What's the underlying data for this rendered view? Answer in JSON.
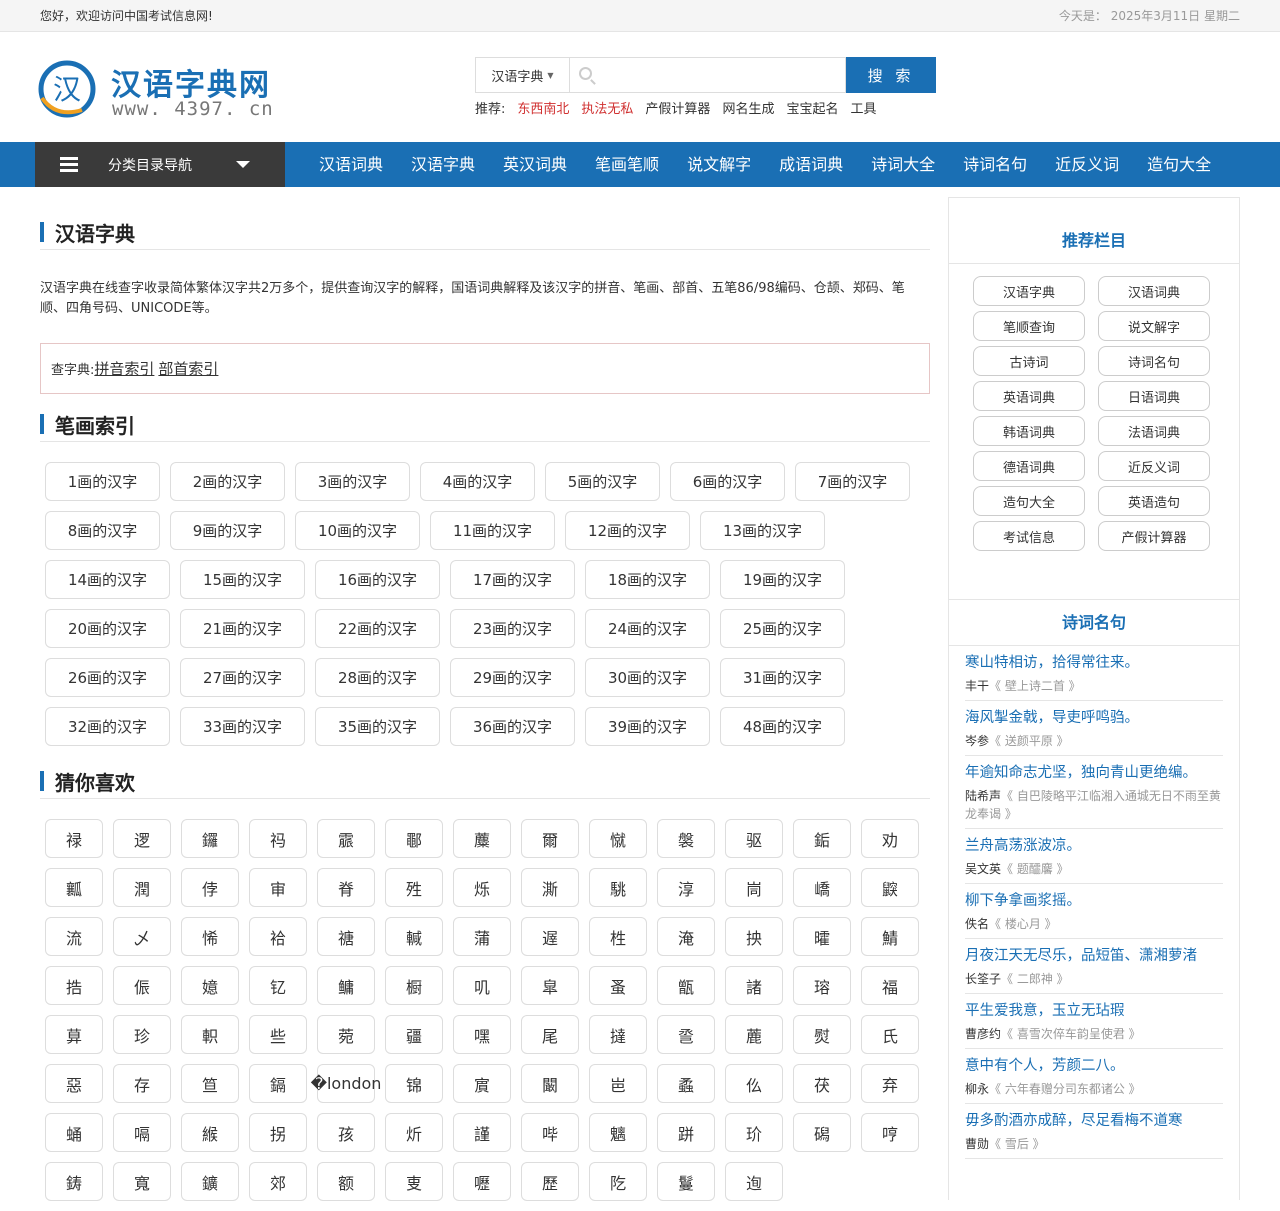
{
  "topbar": {
    "welcome": "您好，欢迎访问中国考试信息网!",
    "today": "今天是：  2025年3月11日 星期二"
  },
  "logo": {
    "name": "汉语字典网",
    "url": "www. 4397. cn",
    "mark": "汉"
  },
  "search": {
    "category": "汉语字典",
    "placeholder": "",
    "button": "搜 索"
  },
  "recommend": {
    "label": "推荐:",
    "hot": [
      "东西南北",
      "执法无私"
    ],
    "links": [
      "产假计算器",
      "网名生成",
      "宝宝起名",
      "工具"
    ]
  },
  "nav": {
    "category_menu": "分类目录导航",
    "links": [
      "汉语词典",
      "汉语字典",
      "英汉词典",
      "笔画笔顺",
      "说文解字",
      "成语词典",
      "诗词大全",
      "诗词名句",
      "近反义词",
      "造句大全"
    ]
  },
  "main": {
    "section1_title": "汉语字典",
    "description": "汉语字典在线查字收录简体繁体汉字共2万多个，提供查询汉字的解释，国语词典解释及该汉字的拼音、笔画、部首、五笔86/98编码、仓颉、郑码、笔顺、四角号码、UNICODE等。",
    "lookup_label": "查字典:",
    "lookup_links": [
      "拼音索引",
      "部首索引"
    ],
    "section2_title": "笔画索引",
    "strokes": [
      "1画的汉字",
      "2画的汉字",
      "3画的汉字",
      "4画的汉字",
      "5画的汉字",
      "6画的汉字",
      "7画的汉字",
      "8画的汉字",
      "9画的汉字",
      "10画的汉字",
      "11画的汉字",
      "12画的汉字",
      "13画的汉字",
      "14画的汉字",
      "15画的汉字",
      "16画的汉字",
      "17画的汉字",
      "18画的汉字",
      "19画的汉字",
      "20画的汉字",
      "21画的汉字",
      "22画的汉字",
      "23画的汉字",
      "24画的汉字",
      "25画的汉字",
      "26画的汉字",
      "27画的汉字",
      "28画的汉字",
      "29画的汉字",
      "30画的汉字",
      "31画的汉字",
      "32画的汉字",
      "33画的汉字",
      "35画的汉字",
      "36画的汉字",
      "39画的汉字",
      "48画的汉字"
    ],
    "section3_title": "猜你喜欢",
    "chars": [
      "禄",
      "逻",
      "鑼",
      "祃",
      "霢",
      "鄳",
      "蘪",
      "爾",
      "憱",
      "褩",
      "驱",
      "銗",
      "劝",
      "瓤",
      "潤",
      "侼",
      "审",
      "脊",
      "殅",
      "烁",
      "澌",
      "駣",
      "淳",
      "峝",
      "嶠",
      "鼵",
      "流",
      "乄",
      "悕",
      "袷",
      "禟",
      "輱",
      "蒲",
      "遟",
      "栍",
      "淹",
      "抰",
      "曤",
      "鯖",
      "捁",
      "侲",
      "嬑",
      "钇",
      "鳙",
      "橱",
      "叽",
      "皐",
      "蚤",
      "甑",
      "諸",
      "瑢",
      "福",
      "萛",
      "珍",
      "軹",
      "些",
      "菀",
      "疆",
      "嘿",
      "尾",
      "撻",
      "巹",
      "蔍",
      "熨",
      "氏",
      "惡",
      "存",
      "笪",
      "鎘",
      "�london",
      "锦",
      "賔",
      "闞",
      "岜",
      "蟊",
      "仫",
      "茯",
      "弃",
      "蛹",
      "嗝",
      "緱",
      "拐",
      "孩",
      "炘",
      "謹",
      "哔",
      "魑",
      "跰",
      "玠",
      "磶",
      "哼",
      "鋳",
      "寬",
      "鑛",
      "郊",
      "额",
      "叓",
      "嚦",
      "歷",
      "阣",
      "鬘",
      "迿"
    ]
  },
  "sidebar": {
    "recommend_title": "推荐栏目",
    "recommend_items": [
      "汉语字典",
      "汉语词典",
      "笔顺查询",
      "说文解字",
      "古诗词",
      "诗词名句",
      "英语词典",
      "日语词典",
      "韩语词典",
      "法语词典",
      "德语词典",
      "近反义词",
      "造句大全",
      "英语造句",
      "考试信息",
      "产假计算器"
    ],
    "poems_title": "诗词名句",
    "poems": [
      {
        "line": "寒山特相访，拾得常往来。",
        "author": "丰干",
        "work": "《 壁上诗二首 》"
      },
      {
        "line": "海风掣金戟，导吏呼鸣驺。",
        "author": "岑参",
        "work": "《 送颜平原 》"
      },
      {
        "line": "年逾知命志尤坚，独向青山更绝编。",
        "author": "陆希声",
        "work": "《 自巴陵略平江临湘入通城无日不雨至黄龙奉谒 》"
      },
      {
        "line": "兰舟高荡涨波凉。",
        "author": "吴文英",
        "work": "《 题醽麘 》"
      },
      {
        "line": "柳下争拿画浆摇。",
        "author": "佚名",
        "work": "《 楼心月 》"
      },
      {
        "line": "月夜江天无尽乐，品短笛、潇湘萝渚",
        "author": "长筌子",
        "work": "《 二郎神 》"
      },
      {
        "line": "平生爱我意，玉立无玷瑕",
        "author": "曹彦约",
        "work": "《 喜雪次倅车韵呈使君 》"
      },
      {
        "line": "意中有个人，芳颜二八。",
        "author": "柳永",
        "work": "《 六年春赠分司东都诸公 》"
      },
      {
        "line": "毋多酌酒亦成醉，尽足看梅不道寒",
        "author": "曹勋",
        "work": "《 雪后 》"
      }
    ]
  }
}
